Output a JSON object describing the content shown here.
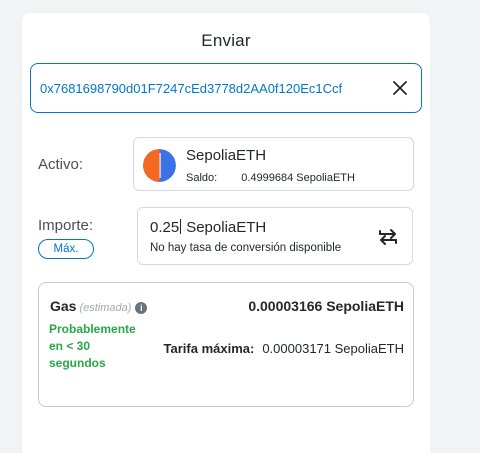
{
  "title": "Enviar",
  "recipient": {
    "address": "0x7681698790d01F7247cEd3778d2AA0f120Ec1Ccf"
  },
  "asset": {
    "label": "Activo:",
    "name": "SepoliaETH",
    "balance_label": "Saldo:",
    "balance_value": "0.4999684 SepoliaETH",
    "icon_colors": [
      "#f56821",
      "#3b73e6"
    ]
  },
  "amount": {
    "label": "Importe:",
    "max_label": "Máx.",
    "value": "0.25",
    "unit": "SepoliaETH",
    "conversion_text": "No hay tasa de conversión disponible"
  },
  "gas": {
    "label": "Gas",
    "estimated_label": "(estimada)",
    "amount": "0.00003166 SepoliaETH",
    "time_text": "Probablemente en < 30 segundos",
    "max_fee_label": "Tarifa máxima:",
    "max_fee_value": "0.00003171 SepoliaETH"
  },
  "colors": {
    "accent": "#0376c9",
    "success": "#28a745",
    "text": "#24272a"
  }
}
